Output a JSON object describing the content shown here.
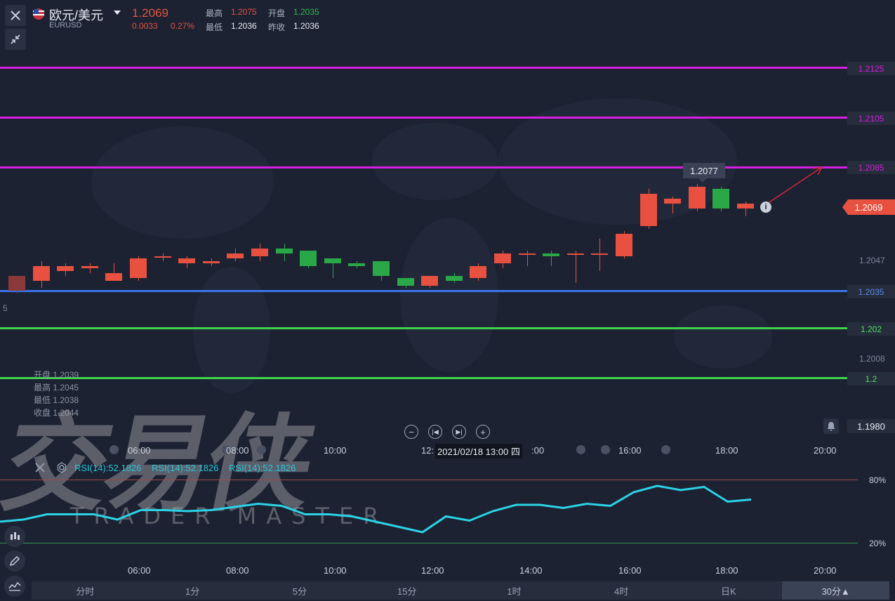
{
  "header": {
    "symbol_name": "欧元/美元",
    "symbol_code": "EURUSD",
    "last_price": "1.2069",
    "change": "0.0033",
    "change_pct": "0.27%",
    "high_label": "最高",
    "high_value": "1.2075",
    "open_label": "开盘",
    "open_value": "1.2035",
    "low_label": "最低",
    "low_value": "1.2036",
    "prev_close_label": "昨收",
    "prev_close_value": "1.2036",
    "close_icon": "close-icon",
    "collapse_icon": "collapse-arrows-icon",
    "flag_icon": "us-flag-icon",
    "dropdown_icon": "chevron-down-icon"
  },
  "level_lines": [
    {
      "price": "1.2125",
      "color": "#d81ee0"
    },
    {
      "price": "1.2105",
      "color": "#d81ee0"
    },
    {
      "price": "1.2085",
      "color": "#d81ee0"
    },
    {
      "price": "1.2035",
      "color": "#3b74e8"
    },
    {
      "price": "1.202",
      "color": "#3ed44a"
    },
    {
      "price": "1.2",
      "color": "#3ed44a"
    }
  ],
  "price_axis": {
    "current_price": "1.2069",
    "ticks": [
      "1.2047",
      "1.2008"
    ],
    "left_edge_label": "5",
    "bottom_value": "1.1980",
    "bell_icon": "bell-icon"
  },
  "tooltip_price": "1.2077",
  "ohlc_panel": {
    "open": "开盘 1.2039",
    "high": "最高 1.2045",
    "low": "最低 1.2038",
    "close": "收盘 1.2044"
  },
  "nav_controls": [
    "zoom-out-icon",
    "skip-back-icon",
    "skip-forward-icon",
    "zoom-in-icon"
  ],
  "time_axis": {
    "labels": [
      "06:00",
      "08:00",
      "10:00",
      "12:",
      "16:00",
      "18:00",
      "20:00"
    ],
    "crosshair_label": "2021/02/18 13:00 四",
    "crosshair_suffix": ":00"
  },
  "rsi": {
    "labels": [
      "RSI(14):52.1826",
      "RSI(14):52.1826",
      "RSI(14):52.1826"
    ],
    "upper": "80%",
    "lower": "20%",
    "close_icon": "close-icon",
    "settings_icon": "settings-icon",
    "line_color": "#2bd3e6",
    "values": [
      20,
      22,
      27,
      27,
      27,
      22,
      31,
      31,
      30,
      31,
      34,
      37,
      35,
      27,
      27,
      25,
      20,
      15,
      10,
      25,
      21,
      30,
      36,
      36,
      33,
      37,
      35,
      48,
      54,
      50,
      53,
      39,
      41
    ]
  },
  "bottom_time_axis": [
    "06:00",
    "08:00",
    "10:00",
    "12:00",
    "14:00",
    "16:00",
    "18:00",
    "20:00"
  ],
  "side_tools": [
    "candlestick-icon",
    "pencil-icon",
    "indicator-icon"
  ],
  "watermark": {
    "main": "交易侠",
    "sub": "TRADER MASTER"
  },
  "period_tabs": [
    {
      "label": "分时",
      "active": false
    },
    {
      "label": "1分",
      "active": false
    },
    {
      "label": "5分",
      "active": false
    },
    {
      "label": "15分",
      "active": false
    },
    {
      "label": "1时",
      "active": false
    },
    {
      "label": "4时",
      "active": false
    },
    {
      "label": "日K",
      "active": false
    },
    {
      "label": "30分▲",
      "active": true
    }
  ],
  "candles": [
    {
      "o": 1.2041,
      "c": 1.2035,
      "h": 1.2041,
      "l": 1.2034
    },
    {
      "o": 1.2039,
      "c": 1.2045,
      "h": 1.2047,
      "l": 1.2036
    },
    {
      "o": 1.2043,
      "c": 1.2045,
      "h": 1.2046,
      "l": 1.2041
    },
    {
      "o": 1.2044,
      "c": 1.2045,
      "h": 1.2046,
      "l": 1.2042
    },
    {
      "o": 1.2039,
      "c": 1.2042,
      "h": 1.2046,
      "l": 1.2039
    },
    {
      "o": 1.204,
      "c": 1.2048,
      "h": 1.2049,
      "l": 1.2039
    },
    {
      "o": 1.2049,
      "c": 1.2049,
      "h": 1.205,
      "l": 1.2047
    },
    {
      "o": 1.2046,
      "c": 1.2048,
      "h": 1.2049,
      "l": 1.2044
    },
    {
      "o": 1.2046,
      "c": 1.2047,
      "h": 1.2048,
      "l": 1.2045
    },
    {
      "o": 1.2048,
      "c": 1.205,
      "h": 1.2052,
      "l": 1.2047
    },
    {
      "o": 1.2049,
      "c": 1.2052,
      "h": 1.2054,
      "l": 1.2047
    },
    {
      "o": 1.2052,
      "c": 1.205,
      "h": 1.2054,
      "l": 1.2047
    },
    {
      "o": 1.2051,
      "c": 1.2045,
      "h": 1.2051,
      "l": 1.2044
    },
    {
      "o": 1.2048,
      "c": 1.2046,
      "h": 1.2048,
      "l": 1.204
    },
    {
      "o": 1.2046,
      "c": 1.2045,
      "h": 1.2047,
      "l": 1.2044
    },
    {
      "o": 1.2047,
      "c": 1.2041,
      "h": 1.2047,
      "l": 1.2039
    },
    {
      "o": 1.204,
      "c": 1.2037,
      "h": 1.204,
      "l": 1.2036
    },
    {
      "o": 1.2037,
      "c": 1.2041,
      "h": 1.2041,
      "l": 1.2036
    },
    {
      "o": 1.2041,
      "c": 1.2039,
      "h": 1.2042,
      "l": 1.2038
    },
    {
      "o": 1.204,
      "c": 1.2045,
      "h": 1.2046,
      "l": 1.2039
    },
    {
      "o": 1.2046,
      "c": 1.205,
      "h": 1.2051,
      "l": 1.2044
    },
    {
      "o": 1.205,
      "c": 1.205,
      "h": 1.2051,
      "l": 1.2045
    },
    {
      "o": 1.205,
      "c": 1.2049,
      "h": 1.2051,
      "l": 1.2045
    },
    {
      "o": 1.205,
      "c": 1.205,
      "h": 1.2051,
      "l": 1.2038
    },
    {
      "o": 1.205,
      "c": 1.205,
      "h": 1.2056,
      "l": 1.2043
    },
    {
      "o": 1.2049,
      "c": 1.2058,
      "h": 1.2059,
      "l": 1.2048
    },
    {
      "o": 1.2061,
      "c": 1.2074,
      "h": 1.2076,
      "l": 1.206
    },
    {
      "o": 1.207,
      "c": 1.2072,
      "h": 1.2073,
      "l": 1.2066
    },
    {
      "o": 1.2068,
      "c": 1.2077,
      "h": 1.2078,
      "l": 1.2067
    },
    {
      "o": 1.2076,
      "c": 1.2068,
      "h": 1.2077,
      "l": 1.2067
    },
    {
      "o": 1.2068,
      "c": 1.207,
      "h": 1.2071,
      "l": 1.2065
    }
  ]
}
